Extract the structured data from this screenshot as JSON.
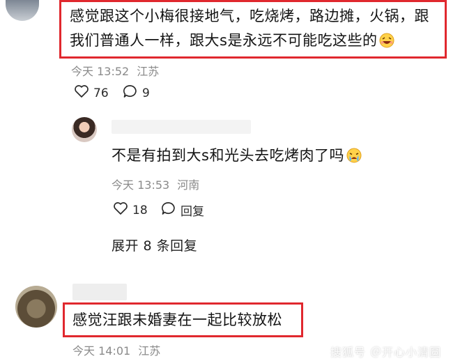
{
  "comments": [
    {
      "text_line1": "感觉跟这个小梅很接地气，吃烧烤，路边摊，火锅，跟",
      "text_line2": "我们普通人一样，跟大s是永远不可能吃这些的",
      "emoji_icon": "laughing-face-emoji-icon",
      "time": "今天 13:52",
      "location": "江苏",
      "likes": "76",
      "replies": "9"
    },
    {
      "text": "不是有拍到大s和光头去吃烤肉了吗",
      "emoji_icon": "crying-face-emoji-icon",
      "time": "今天 13:53",
      "location": "河南",
      "likes": "18",
      "reply_label": "回复",
      "expand_label": "展开 8 条回复"
    },
    {
      "text": "感觉汪跟未婚妻在一起比较放松",
      "time": "今天 14:01",
      "location": "江苏"
    }
  ],
  "watermark": "搜狐号 ＠开心小清圆",
  "colors": {
    "highlight_border": "#e0282e",
    "meta_text": "#8a8a8a"
  }
}
